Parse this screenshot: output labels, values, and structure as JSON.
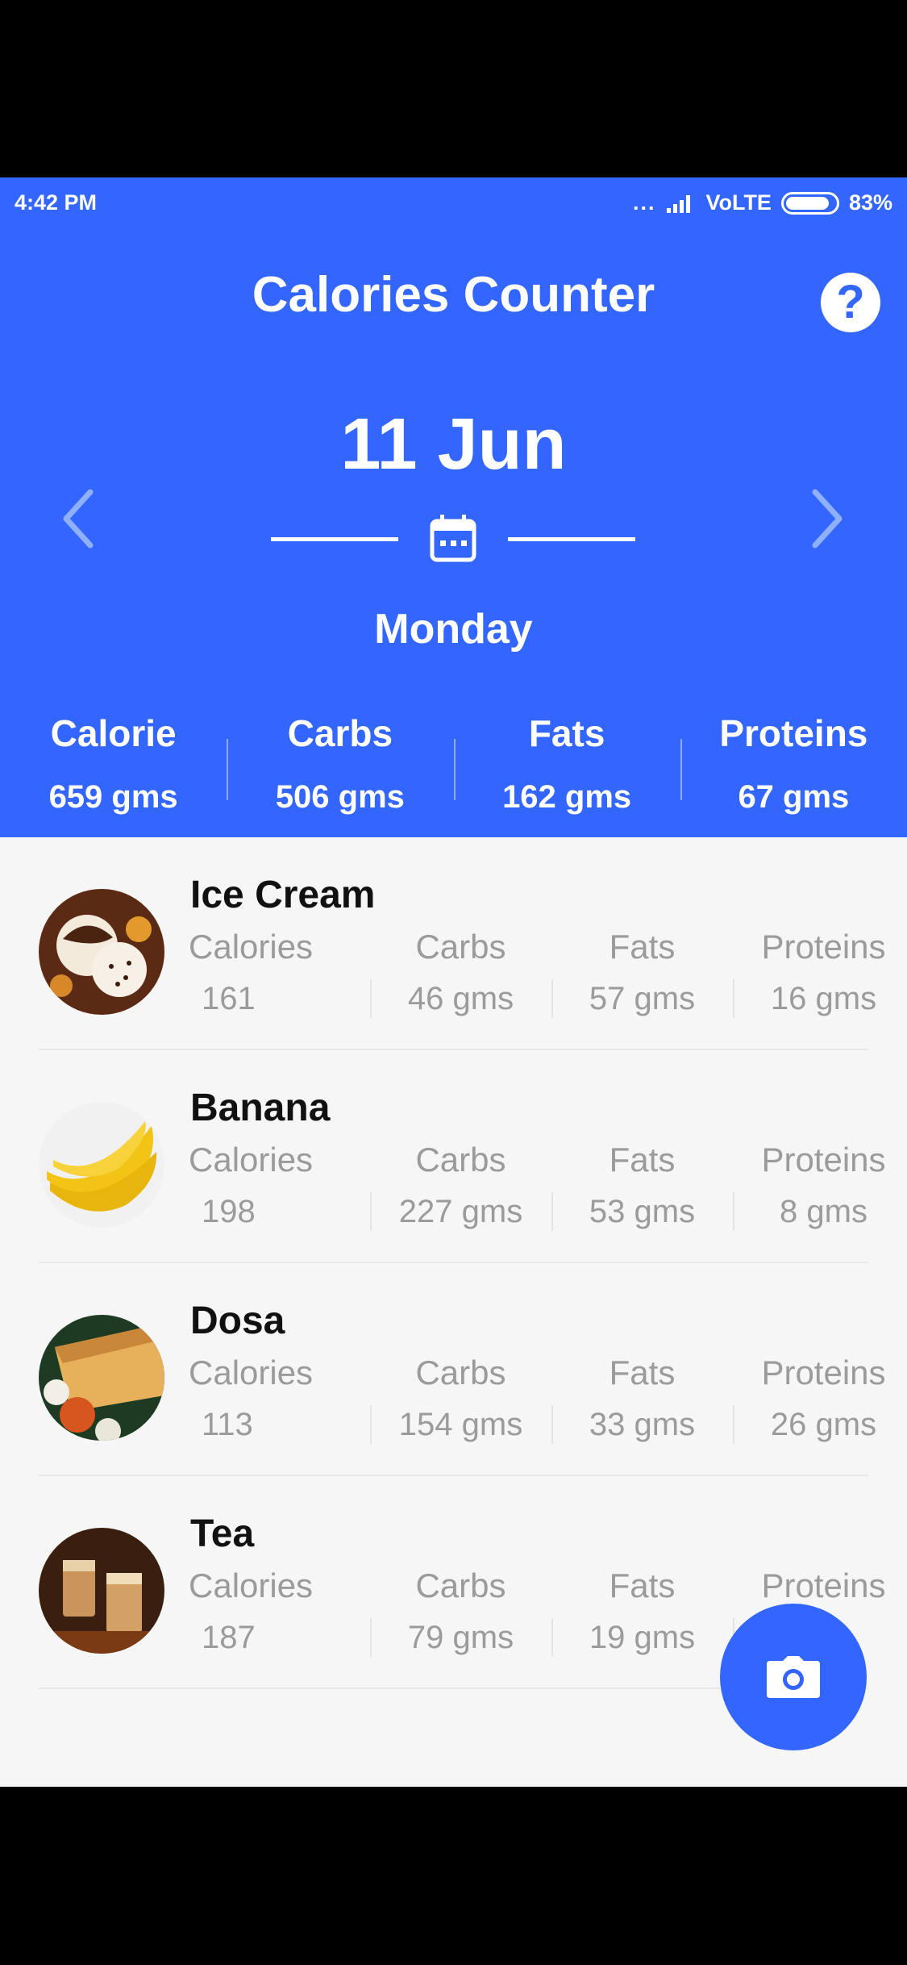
{
  "status_bar": {
    "time": "4:42 PM",
    "dots": "...",
    "network": "VoLTE",
    "battery": "83%"
  },
  "header": {
    "title": "Calories Counter",
    "date": "11 Jun",
    "day": "Monday"
  },
  "summary": [
    {
      "label": "Calorie",
      "value": "659 gms"
    },
    {
      "label": "Carbs",
      "value": "506 gms"
    },
    {
      "label": "Fats",
      "value": "162 gms"
    },
    {
      "label": "Proteins",
      "value": "67 gms"
    }
  ],
  "nutrient_labels": [
    "Calories",
    "Carbs",
    "Fats",
    "Proteins"
  ],
  "foods": [
    {
      "name": "Ice Cream",
      "values": [
        "161",
        "46 gms",
        "57 gms",
        "16 gms"
      ]
    },
    {
      "name": "Banana",
      "values": [
        "198",
        "227 gms",
        "53 gms",
        "8 gms"
      ]
    },
    {
      "name": "Dosa",
      "values": [
        "113",
        "154 gms",
        "33 gms",
        "26 gms"
      ]
    },
    {
      "name": "Tea",
      "values": [
        "187",
        "79 gms",
        "19 gms",
        ""
      ]
    }
  ],
  "colors": {
    "primary": "#3366ff",
    "background": "#f5f6f5",
    "muted_text": "#9b9b9b"
  },
  "icons": [
    "help-icon",
    "chevron-left-icon",
    "chevron-right-icon",
    "calendar-icon",
    "camera-icon"
  ]
}
